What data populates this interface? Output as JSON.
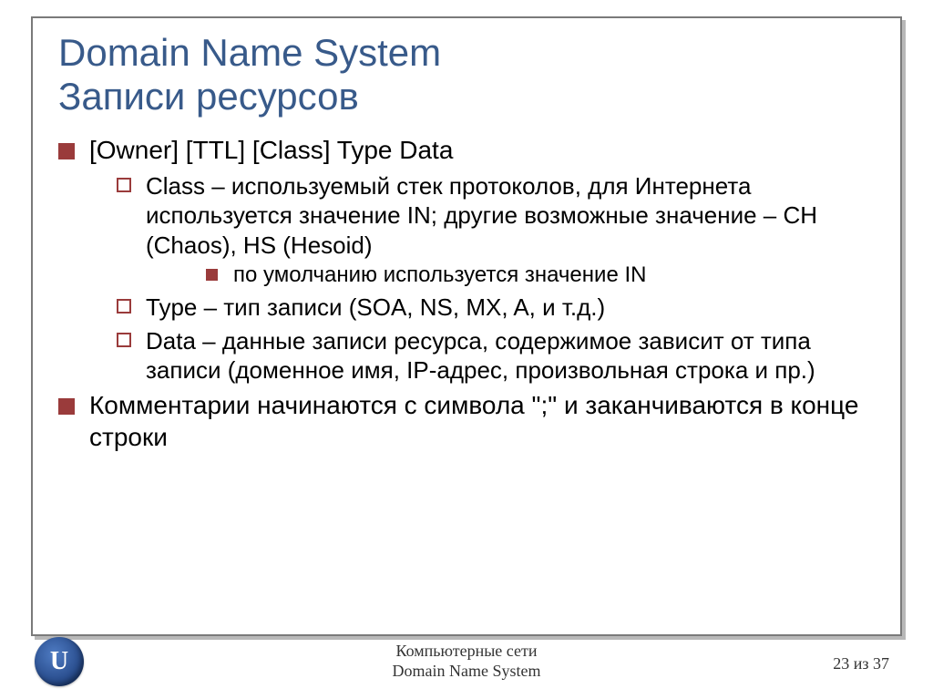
{
  "title_line1": "Domain Name System",
  "title_line2": "Записи ресурсов",
  "bullets": {
    "l1_0": "[Owner]  [TTL]  [Class]  Type  Data",
    "l2_0": "Class – используемый стек протоколов, для Интернета используется значение IN; другие возможные значение – CH (Chaos), HS (Hesoid)",
    "l3_0": "по умолчанию используется значение IN",
    "l2_1": "Type – тип записи (SOA, NS, MX, A, и т.д.)",
    "l2_2": "Data – данные записи ресурса, содержимое зависит от типа записи (доменное имя, IP-адрес, произвольная строка и пр.)",
    "l1_1": "Комментарии начинаются с символа \";\" и заканчиваются в конце строки"
  },
  "footer": {
    "line1": "Компьютерные сети",
    "line2": "Domain Name System",
    "page": "23 из 37",
    "logo_letter": "U"
  }
}
